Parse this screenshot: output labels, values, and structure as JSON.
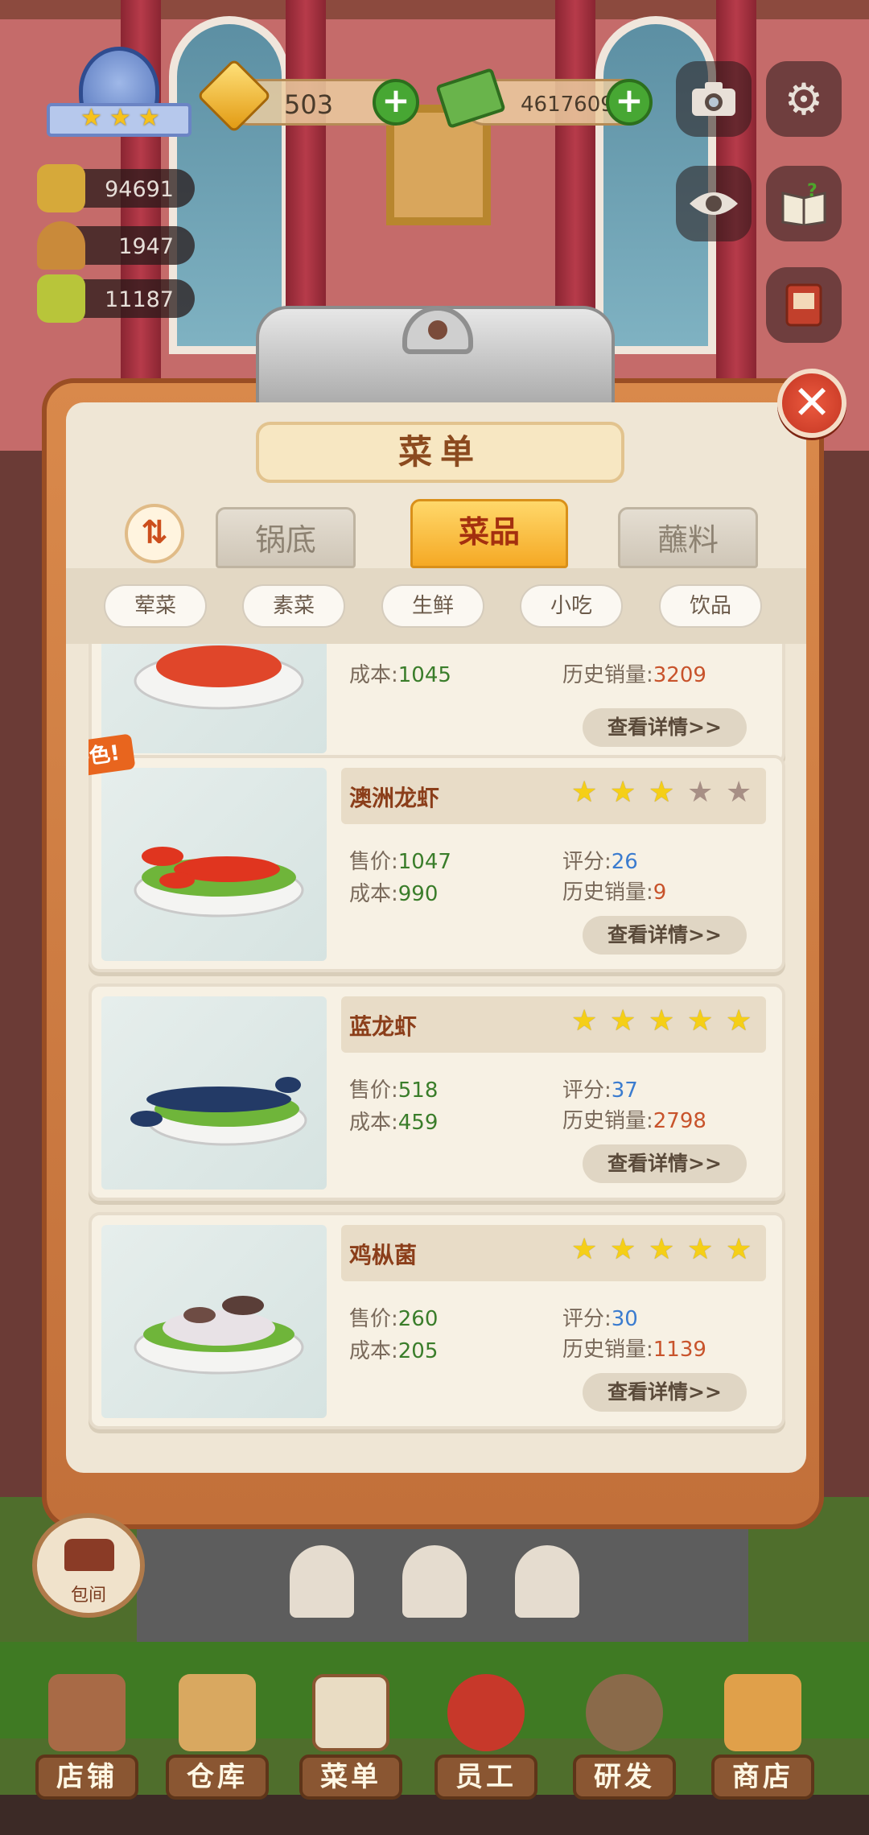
{
  "hud": {
    "level_stars": 3,
    "stats": [
      {
        "icon": "popularity-icon",
        "value": "94691"
      },
      {
        "icon": "dish-cover-icon",
        "value": "1947"
      },
      {
        "icon": "book-icon",
        "value": "11187"
      }
    ],
    "gems": "503",
    "cash": "4617609"
  },
  "menu": {
    "title": "菜单",
    "sort_glyph": "⇅",
    "tabs": [
      "锅底",
      "菜品",
      "蘸料"
    ],
    "active_tab": "菜品",
    "filters": [
      "荤菜",
      "素菜",
      "生鲜",
      "小吃",
      "饮品"
    ]
  },
  "labels": {
    "price": "售价:",
    "cost": "成本:",
    "rating": "评分:",
    "sales": "历史销量:",
    "detail": "查看详情>>",
    "special": "特色!"
  },
  "partial_item": {
    "cost": "1045",
    "sales": "3209"
  },
  "items": [
    {
      "name": "澳洲龙虾",
      "stars": 3,
      "price": "1047",
      "cost": "990",
      "rating": "26",
      "sales": "9",
      "special": true
    },
    {
      "name": "蓝龙虾",
      "stars": 5,
      "price": "518",
      "cost": "459",
      "rating": "37",
      "sales": "2798",
      "special": false
    },
    {
      "name": "鸡枞菌",
      "stars": 5,
      "price": "260",
      "cost": "205",
      "rating": "30",
      "sales": "1139",
      "special": false
    }
  ],
  "side_button": {
    "label": "包间"
  },
  "nav": [
    "店铺",
    "仓库",
    "菜单",
    "员工",
    "研发",
    "商店"
  ],
  "colors": {
    "accent_orange": "#f5a925",
    "wall": "#c56b6a",
    "board": "#c2703a",
    "paper": "#efe6d5"
  }
}
